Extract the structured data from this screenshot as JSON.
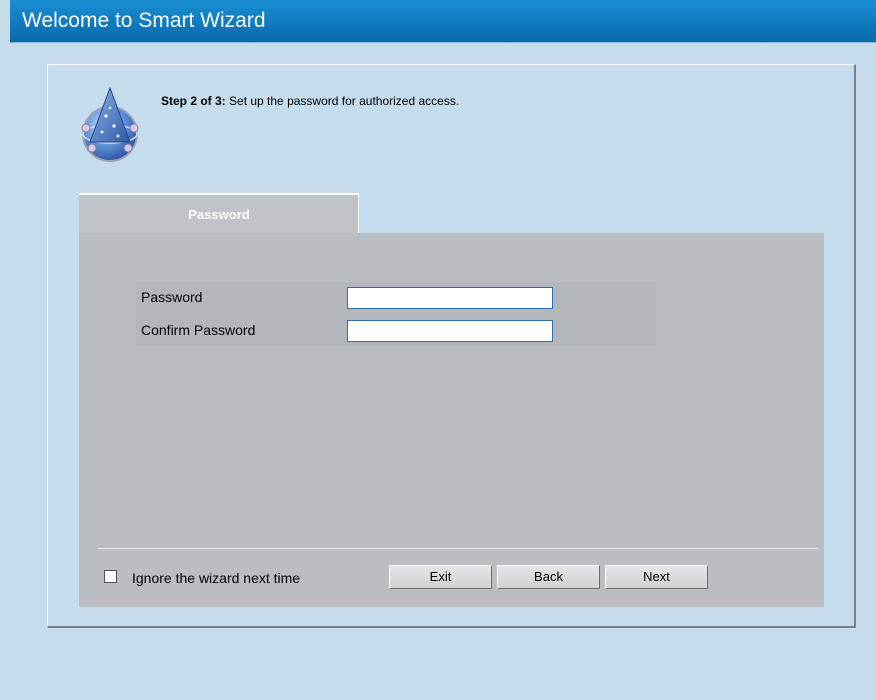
{
  "window": {
    "title": "Welcome to Smart Wizard"
  },
  "step": {
    "prefix": "Step 2 of 3:",
    "description": " Set up the password for authorized access."
  },
  "tab": {
    "label": "Password"
  },
  "form": {
    "password_label": "Password",
    "password_value": "",
    "confirm_label": "Confirm Password",
    "confirm_value": ""
  },
  "footer": {
    "ignore_checkbox_checked": false,
    "ignore_label": "Ignore the wizard next time",
    "exit_label": "Exit",
    "back_label": "Back",
    "next_label": "Next"
  },
  "colors": {
    "title_bar": "#0f78bd",
    "background": "#c5dcec",
    "content_panel": "#babdc1",
    "tab": "#c0c4c8"
  },
  "icons": {
    "wizard": "wizard-hat-icon"
  }
}
